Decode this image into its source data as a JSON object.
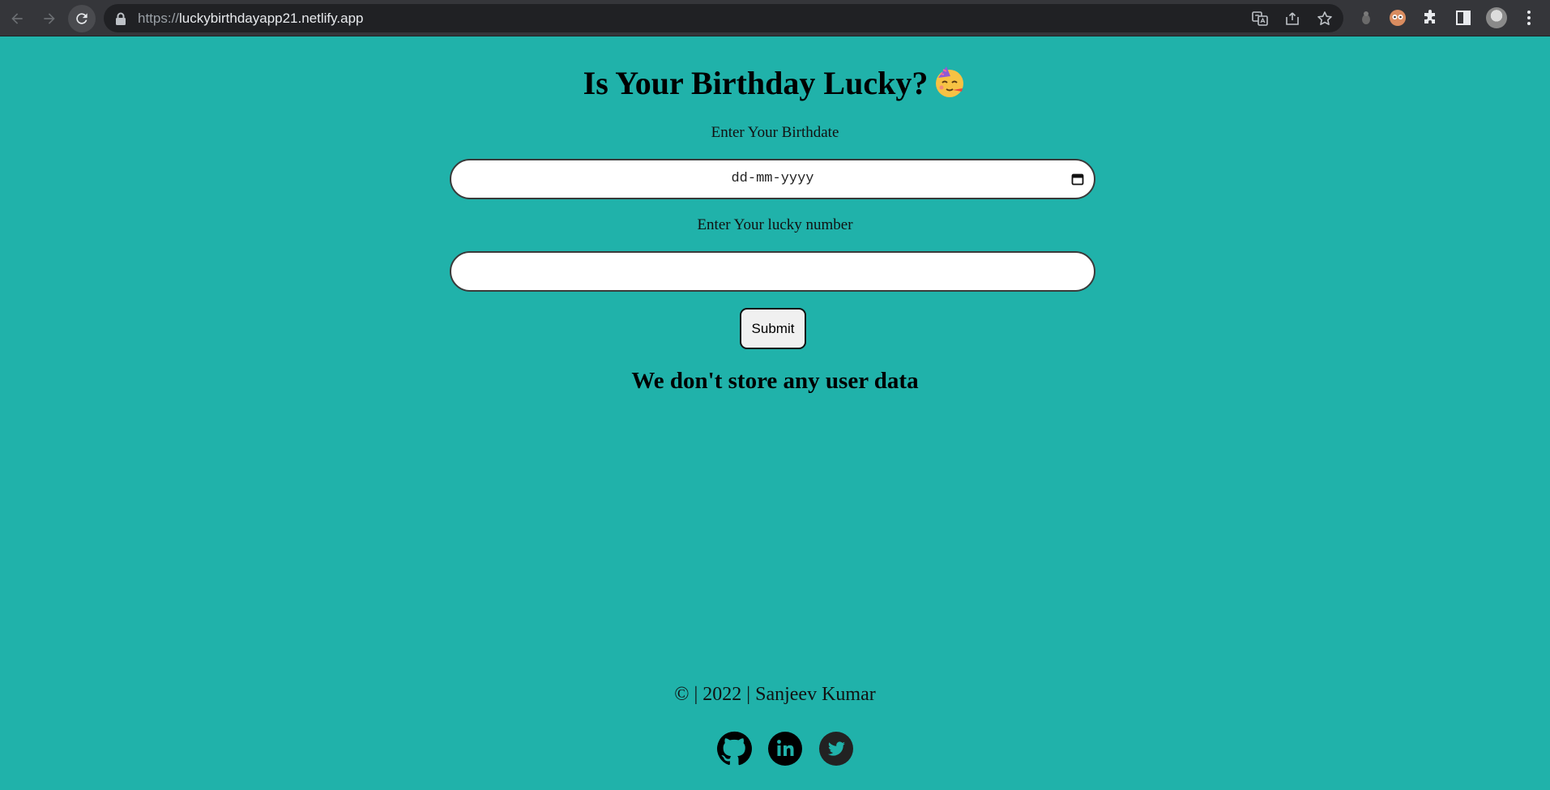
{
  "browser": {
    "url_scheme": "https://",
    "url_host": "luckybirthdayapp21.netlify.app",
    "icons": [
      "back-icon",
      "forward-icon",
      "reload-icon",
      "lock-icon",
      "translate-icon",
      "share-icon",
      "bookmark-star-icon",
      "extension-icon",
      "extension-icon",
      "puzzle-icon",
      "side-panel-icon",
      "profile-avatar",
      "menu-icon"
    ]
  },
  "page": {
    "title": "Is Your Birthday Lucky?",
    "title_emoji": "partying-face",
    "birthdate_label": "Enter Your Birthdate",
    "birthdate_placeholder": "dd-mm-yyyy",
    "lucky_label": "Enter Your lucky number",
    "lucky_value": "",
    "submit_label": "Submit",
    "notice": "We don't store any user data",
    "footer": "© | 2022 | Sanjeev Kumar",
    "social": [
      "github-icon",
      "linkedin-icon",
      "twitter-icon"
    ]
  },
  "colors": {
    "background": "#20b2aa",
    "chrome": "#35363a",
    "omnibox": "#202124"
  }
}
